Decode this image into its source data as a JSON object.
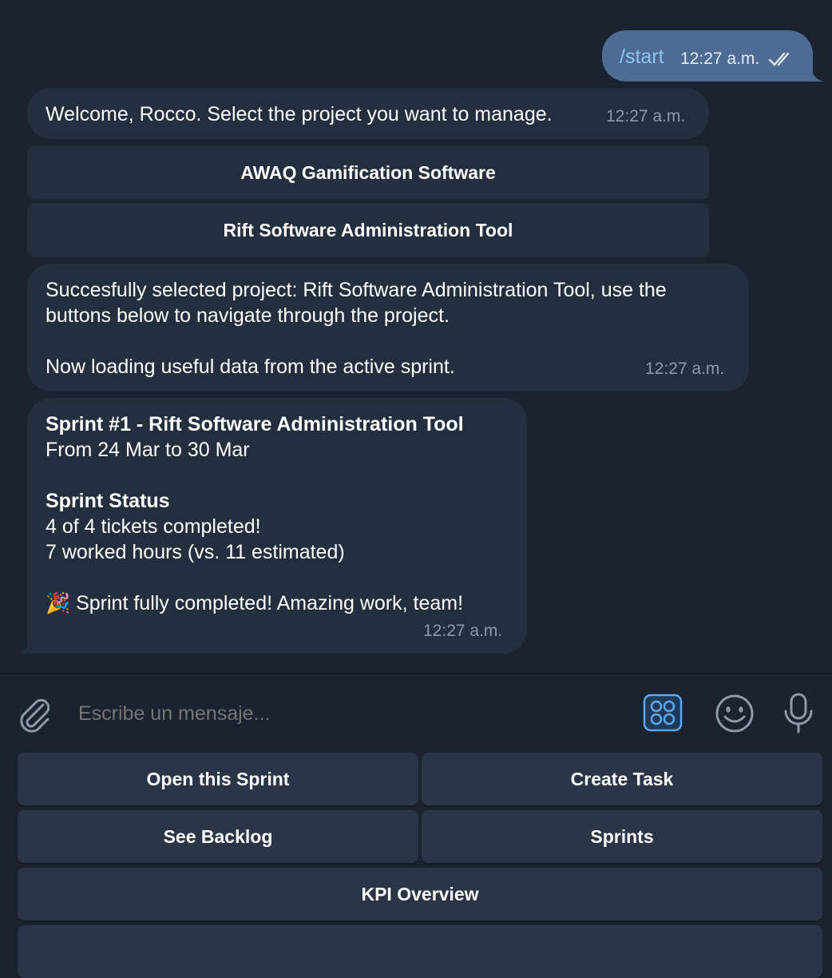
{
  "messages": {
    "start": {
      "text": "/start",
      "time": "12:27 a.m."
    },
    "welcome": {
      "text": "Welcome, Rocco. Select the project you want to manage.",
      "time": "12:27 a.m."
    },
    "project_buttons": [
      "AWAQ Gamification Software",
      "Rift Software Administration Tool"
    ],
    "selected": {
      "line1": "Succesfully selected project: Rift Software Administration Tool, use the",
      "line2": "buttons below to navigate through the project.",
      "line3": "Now loading useful data from the active sprint.",
      "time": "12:27 a.m."
    },
    "sprint": {
      "title": "Sprint #1 - Rift Software Administration Tool",
      "dates": "From 24 Mar to 30 Mar",
      "status_heading": "Sprint Status",
      "tickets": "4 of 4 tickets completed!",
      "hours": "7 worked hours (vs. 11 estimated)",
      "celebrate_emoji": "🎉",
      "celebrate_text": "Sprint fully completed! Amazing work, team!",
      "time": "12:27 a.m."
    }
  },
  "composer": {
    "placeholder": "Escribe un mensaje..."
  },
  "keyboard": {
    "open_sprint": "Open this Sprint",
    "create_task": "Create Task",
    "see_backlog": "See Backlog",
    "sprints": "Sprints",
    "kpi_overview": "KPI Overview"
  },
  "colors": {
    "background": "#1b2330",
    "incoming_bubble": "#232f3f",
    "outgoing_bubble": "#4e6c93",
    "command_link": "#8fc3f2",
    "accent_icon": "#5ba8f0"
  },
  "icons": [
    "double-check-icon",
    "paperclip-icon",
    "bot-menu-icon",
    "emoji-icon",
    "microphone-icon",
    "party-popper-icon"
  ]
}
